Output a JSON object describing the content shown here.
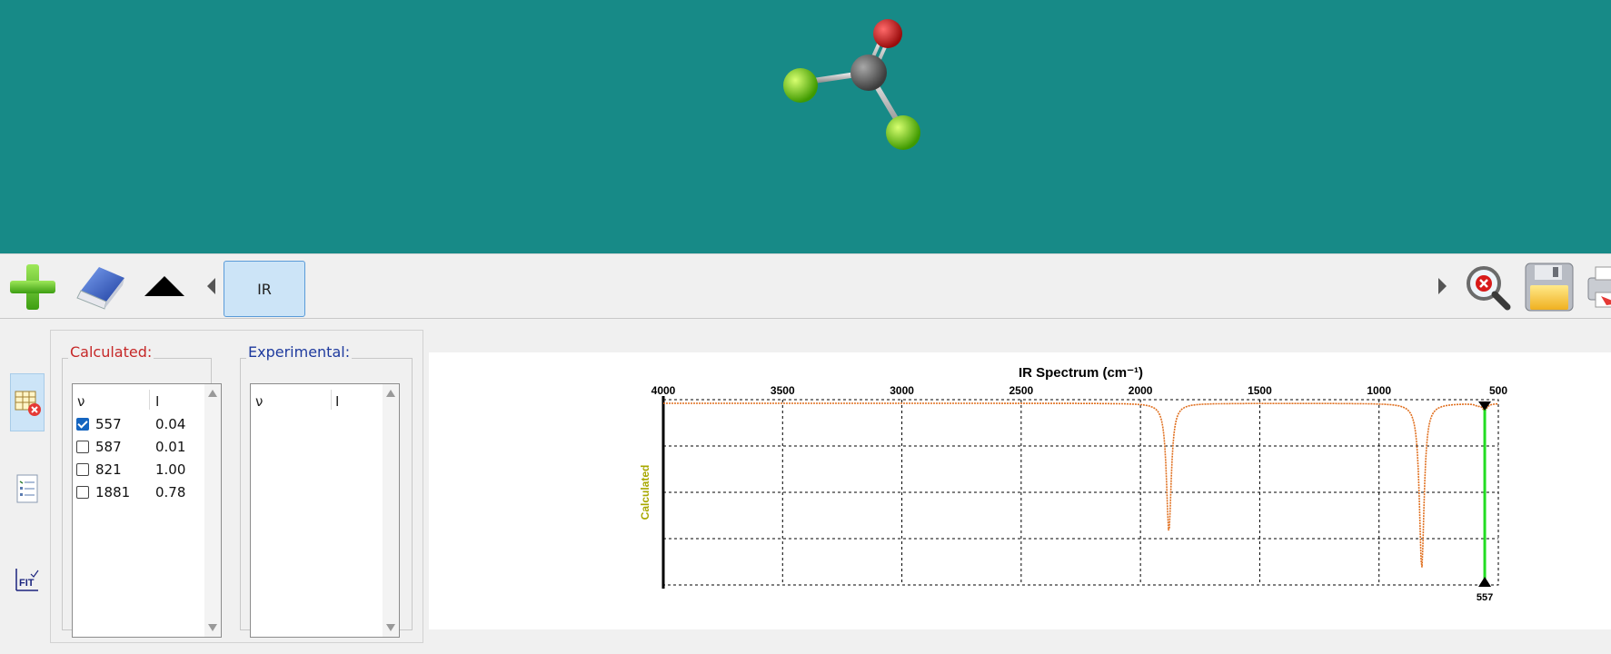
{
  "toolbar": {
    "add_icon": "plus-icon",
    "eraser_icon": "eraser-icon",
    "collapse_icon": "triangle-up-icon",
    "tab_label": "IR",
    "zoom_reset_icon": "zoom-cancel-icon",
    "save_icon": "floppy-disk-icon",
    "print_icon": "printer-icon"
  },
  "side": {
    "table_icon": "table-delete-icon",
    "list_icon": "checklist-icon",
    "fit_icon": "fit-icon",
    "fit_label": "FIT"
  },
  "calculated": {
    "title": "Calculated:",
    "col_v": "ν",
    "col_i": "I",
    "rows": [
      {
        "v": "557",
        "i": "0.04",
        "checked": true
      },
      {
        "v": "587",
        "i": "0.01",
        "checked": false
      },
      {
        "v": "821",
        "i": "1.00",
        "checked": false
      },
      {
        "v": "1881",
        "i": "0.78",
        "checked": false
      }
    ]
  },
  "experimental": {
    "title": "Experimental:",
    "col_v": "ν",
    "col_i": "I"
  },
  "colors": {
    "viewer_bg": "#178a87",
    "calc_title": "#c62828",
    "exp_title": "#1e3a9e",
    "spectrum": "#e07020",
    "marker": "#22dd22",
    "ylabel": "#a8a800"
  },
  "chart_data": {
    "type": "line",
    "title": "IR Spectrum (cm⁻¹)",
    "ylabel": "Calculated",
    "x_ticks": [
      "4000",
      "3500",
      "3000",
      "2500",
      "2000",
      "1500",
      "1000",
      "500"
    ],
    "xlim": [
      4000,
      500
    ],
    "x_reversed": true,
    "grid": true,
    "peaks": [
      {
        "x": 557,
        "intensity": 0.04
      },
      {
        "x": 587,
        "intensity": 0.01
      },
      {
        "x": 821,
        "intensity": 1.0
      },
      {
        "x": 1881,
        "intensity": 0.78
      }
    ],
    "marker": {
      "x": 557,
      "label": "557"
    }
  }
}
